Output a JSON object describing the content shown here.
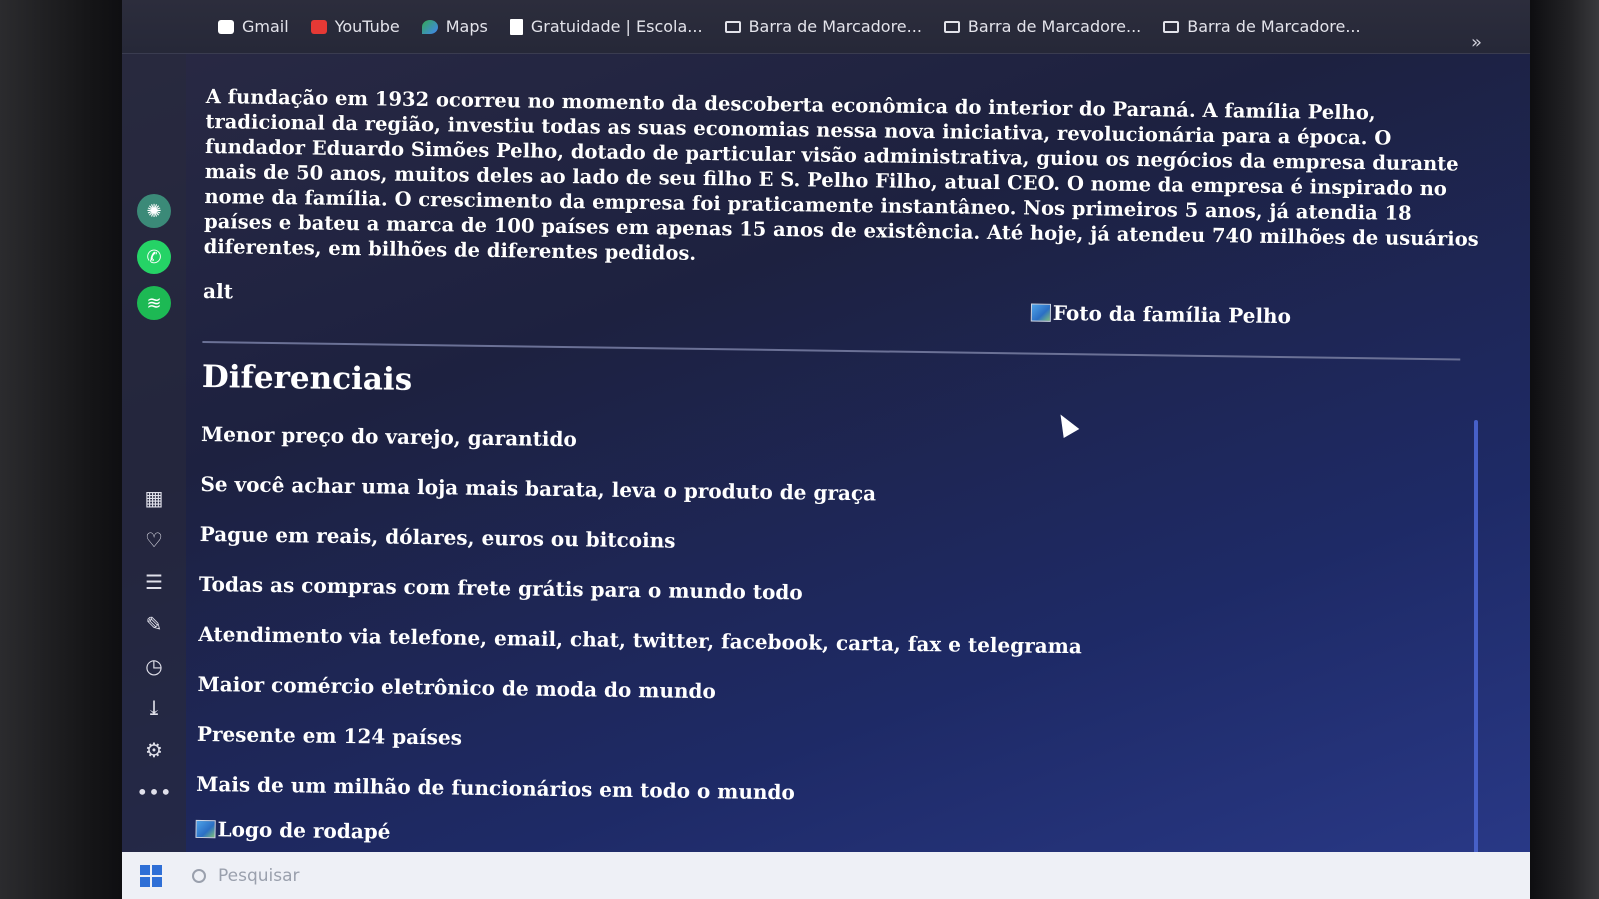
{
  "bookmarks": [
    {
      "label": "Gmail",
      "icon": "gmail-icon"
    },
    {
      "label": "YouTube",
      "icon": "youtube-icon"
    },
    {
      "label": "Maps",
      "icon": "maps-icon"
    },
    {
      "label": "Gratuidade | Escola...",
      "icon": "document-icon"
    },
    {
      "label": "Barra de Marcadore...",
      "icon": "folder-icon"
    },
    {
      "label": "Barra de Marcadore...",
      "icon": "folder-icon"
    },
    {
      "label": "Barra de Marcadore...",
      "icon": "folder-icon"
    }
  ],
  "bookmarks_more": "»",
  "sidebar": {
    "apps": [
      "chatgpt-icon",
      "whatsapp-icon",
      "spotify-icon"
    ],
    "tools": [
      "speed-dial-icon",
      "heart-icon",
      "news-icon",
      "pinboard-icon",
      "history-icon",
      "downloads-icon",
      "settings-icon",
      "more-icon"
    ],
    "more_label": "•••"
  },
  "page": {
    "paragraph": "A fundação em 1932 ocorreu no momento da descoberta econômica do interior do Paraná. A família Pelho, tradicional da região, investiu todas as suas economias nessa nova iniciativa, revolucionária para a época. O fundador Eduardo Simões Pelho, dotado de particular visão administrativa, guiou os negócios da empresa durante mais de 50 anos, muitos deles ao lado de seu filho E S. Pelho Filho, atual CEO. O nome da empresa é inspirado no nome da família. O crescimento da empresa foi praticamente instantâneo. Nos primeiros 5 anos, já atendia 18 países e bateu a marca de 100 países em apenas 15 anos de existência. Até hoje, já atendeu 740 milhões de usuários diferentes, em bilhões de diferentes pedidos.",
    "alt_text": "alt",
    "family_photo_alt": "Foto da família Pelho",
    "section_title": "Diferenciais",
    "features": [
      "Menor preço do varejo, garantido",
      "Se você achar uma loja mais barata, leva o produto de graça",
      "Pague em reais, dólares, euros ou bitcoins",
      "Todas as compras com frete grátis para o mundo todo",
      "Atendimento via telefone, email, chat, twitter, facebook, carta, fax e telegrama",
      "Maior comércio eletrônico de moda do mundo",
      "Presente em 124 países",
      "Mais de um milhão de funcionários em todo o mundo"
    ],
    "footer_logo_alt": "Logo de rodapé"
  },
  "taskbar": {
    "search_placeholder": "Pesquisar"
  }
}
